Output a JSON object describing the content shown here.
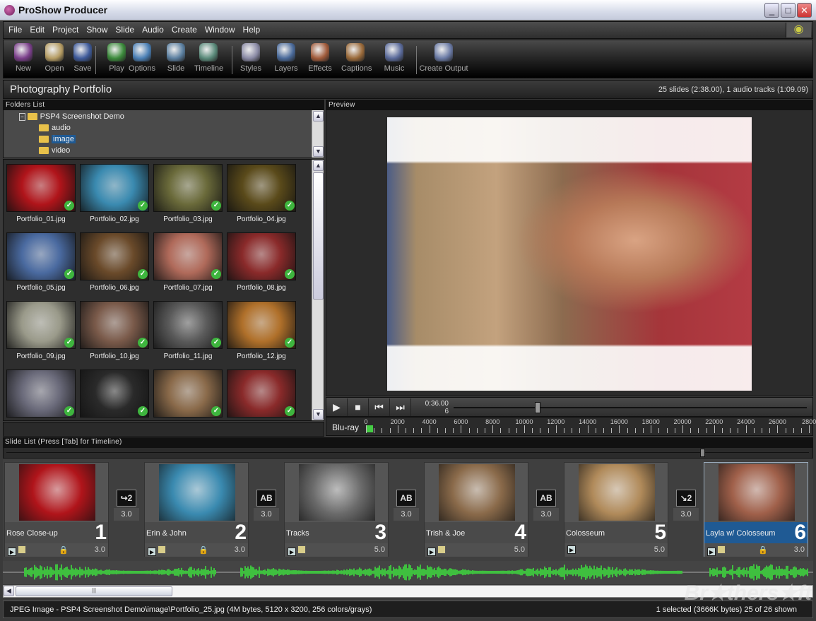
{
  "window": {
    "title": "ProShow Producer",
    "min": "_",
    "max": "□",
    "close": "✕"
  },
  "menu": [
    "File",
    "Edit",
    "Project",
    "Show",
    "Slide",
    "Audio",
    "Create",
    "Window",
    "Help"
  ],
  "toolbar": [
    {
      "label": "New",
      "color": "#7a3e8a"
    },
    {
      "label": "Open",
      "color": "#b59c63"
    },
    {
      "label": "Save",
      "color": "#3e5a9a"
    },
    {
      "label": "Play",
      "color": "#3b8a3b"
    },
    {
      "label": "Options",
      "color": "#4a7fb5"
    },
    {
      "label": "Slide",
      "color": "#5b7fa0"
    },
    {
      "label": "Timeline",
      "color": "#5a8a7a"
    },
    {
      "label": "Styles",
      "color": "#8a8aa5"
    },
    {
      "label": "Layers",
      "color": "#4a6a9a"
    },
    {
      "label": "Effects",
      "color": "#a05a3a"
    },
    {
      "label": "Captions",
      "color": "#9a6a3a"
    },
    {
      "label": "Music",
      "color": "#5a6a9a"
    },
    {
      "label": "Create Output",
      "color": "#6a7aa5"
    }
  ],
  "project": {
    "name": "Photography Portfolio",
    "summary": "25 slides (2:38.00), 1 audio tracks (1:09.09)"
  },
  "folders": {
    "header": "Folders List",
    "root": "PSP4 Screenshot Demo",
    "children": [
      "audio",
      "image",
      "video"
    ],
    "selected": "image"
  },
  "thumbnails": [
    {
      "name": "Portfolio_01.jpg",
      "color": "#b0141a"
    },
    {
      "name": "Portfolio_02.jpg",
      "color": "#3a8ab0"
    },
    {
      "name": "Portfolio_03.jpg",
      "color": "#6a6a3a"
    },
    {
      "name": "Portfolio_04.jpg",
      "color": "#5a4a1a"
    },
    {
      "name": "Portfolio_05.jpg",
      "color": "#4a6aa0"
    },
    {
      "name": "Portfolio_06.jpg",
      "color": "#6a4a2a"
    },
    {
      "name": "Portfolio_07.jpg",
      "color": "#b06a5a"
    },
    {
      "name": "Portfolio_08.jpg",
      "color": "#8a2a2a"
    },
    {
      "name": "Portfolio_09.jpg",
      "color": "#9a9a8a"
    },
    {
      "name": "Portfolio_10.jpg",
      "color": "#7a5a4a"
    },
    {
      "name": "Portfolio_11.jpg",
      "color": "#5a5a5a"
    },
    {
      "name": "Portfolio_12.jpg",
      "color": "#b0702a"
    },
    {
      "name": "",
      "color": "#6a6a7a"
    },
    {
      "name": "",
      "color": "#2a2a2a"
    },
    {
      "name": "",
      "color": "#8a6a4a"
    },
    {
      "name": "",
      "color": "#8a2a2a"
    }
  ],
  "preview": {
    "header": "Preview",
    "time": "0:36.00",
    "slide": "6",
    "position": 0.23
  },
  "ruler": {
    "label": "Blu-ray",
    "ticks": [
      "0",
      "2000",
      "4000",
      "6000",
      "8000",
      "10000",
      "12000",
      "14000",
      "16000",
      "18000",
      "20000",
      "22000",
      "24000",
      "26000",
      "2800"
    ]
  },
  "slide_list": {
    "header": "Slide List (Press [Tab] for Timeline)"
  },
  "slides": [
    {
      "name": "Rose Close-up",
      "num": "1",
      "dur": "3.0",
      "color": "#b0141a",
      "trans": "↪2",
      "tdur": "3.0"
    },
    {
      "name": "Erin & John",
      "num": "2",
      "dur": "3.0",
      "color": "#3a8ab0",
      "trans": "AB",
      "tdur": "3.0"
    },
    {
      "name": "Tracks",
      "num": "3",
      "dur": "5.0",
      "color": "#6a6a6a",
      "trans": "AB",
      "tdur": "3.0"
    },
    {
      "name": "Trish & Joe",
      "num": "4",
      "dur": "5.0",
      "color": "#8a6a4a",
      "trans": "AB",
      "tdur": "3.0"
    },
    {
      "name": "Colosseum",
      "num": "5",
      "dur": "5.0",
      "color": "#b08a5a",
      "trans": "↘2",
      "tdur": "3.0"
    },
    {
      "name": "Layla w/ Colosseum",
      "num": "6",
      "dur": "3.0",
      "color": "#a0604a",
      "selected": true
    }
  ],
  "status": {
    "left": "JPEG Image - PSP4 Screenshot Demo\\image\\Portfolio_25.jpg  (4M bytes, 5120 x 3200, 256 colors/grays)",
    "right": "1 selected (3666K bytes) 25 of 26 shown"
  },
  "watermark": "Brothersoft"
}
